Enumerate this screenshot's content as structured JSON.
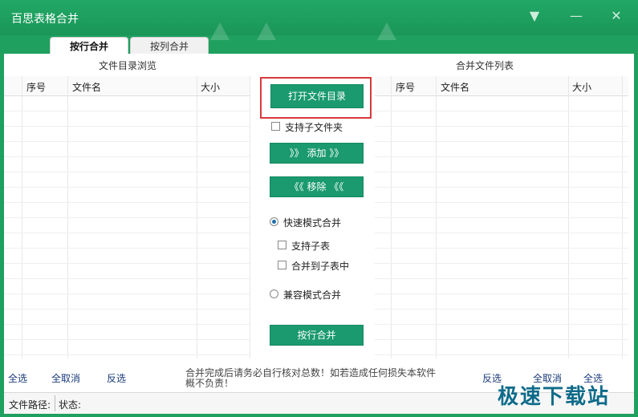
{
  "window": {
    "title": "百思表格合并"
  },
  "tabs": [
    {
      "label": "按行合并"
    },
    {
      "label": "按列合并"
    }
  ],
  "left_panel": {
    "title": "文件目录浏览",
    "columns": [
      "序号",
      "文件名",
      "大小"
    ],
    "select_all": "全选",
    "deselect_all": "全取消",
    "invert": "反选"
  },
  "right_panel": {
    "title": "合并文件列表",
    "columns": [
      "序号",
      "文件名",
      "大小"
    ],
    "invert": "反选",
    "deselect_all": "全取消",
    "select_all": "全选"
  },
  "controls": {
    "open_dir": "打开文件目录",
    "include_subfolders": "支持子文件夹",
    "add": "》》 添加 》》",
    "remove": "《《 移除 《《",
    "fast_mode": "快速模式合并",
    "support_subsheet": "支持子表",
    "merge_to_subsheet": "合并到子表中",
    "compat_mode": "兼容模式合并",
    "merge_by_row": "按行合并"
  },
  "notice": "合并完成后请务必自行核对总数！如若造成任何损失本软件概不负责！",
  "statusbar": {
    "file_path_label": "文件路径:",
    "status_label": "状态:"
  },
  "watermark": "极速下载站"
}
